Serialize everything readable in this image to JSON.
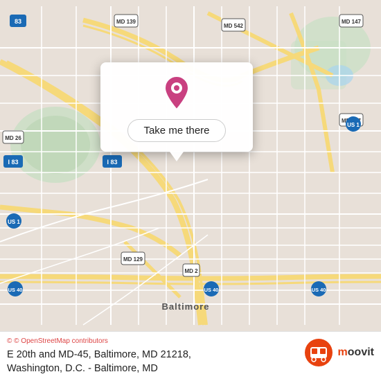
{
  "map": {
    "alt": "Map of Baltimore MD area",
    "popup": {
      "button_label": "Take me there"
    },
    "location": {
      "title": "E 20th and MD-45, Baltimore, MD 21218,",
      "subtitle": "Washington, D.C. - Baltimore, MD"
    }
  },
  "attribution": {
    "text": "© OpenStreetMap contributors"
  },
  "branding": {
    "name": "moovit"
  },
  "colors": {
    "road_highway": "#f6d97a",
    "road_major": "#ffffff",
    "road_minor": "#f0ece4",
    "water": "#a8d4f0",
    "park": "#c8dfc4",
    "pin_color": "#c94080",
    "bg": "#e8e0d8"
  }
}
